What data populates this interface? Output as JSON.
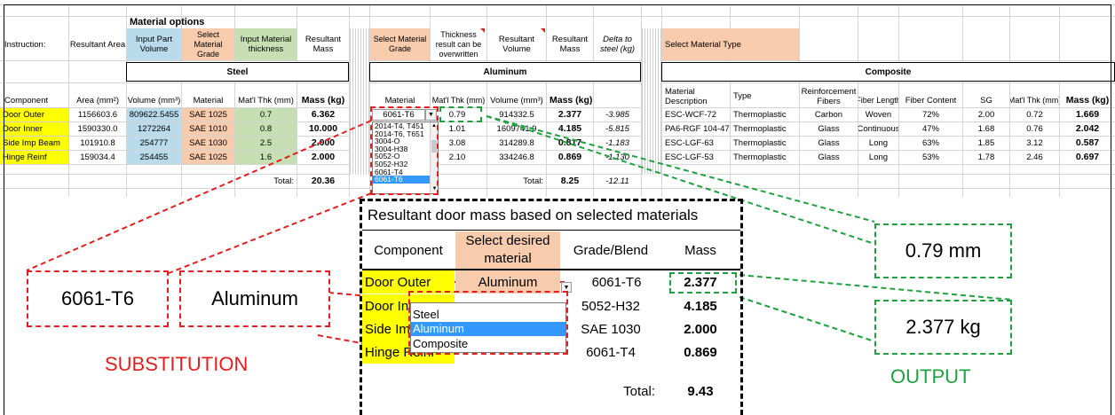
{
  "spreadsheet": {
    "material_options_title": "Material options",
    "instruction_label": "Instruction:",
    "steel_headers": {
      "resultant_area": "Resultant Area",
      "input_part_volume": "Input Part Volume",
      "select_material_grade": "Select Material Grade",
      "input_material_thickness": "Input Material thickness",
      "resultant_mass": "Resultant Mass"
    },
    "aluminum_headers": {
      "select_material_grade": "Select Material Grade",
      "thickness_note": "Thickness result can be overwritten",
      "resultant_volume": "Resultant Volume",
      "resultant_mass": "Resultant Mass",
      "delta_to_steel": "Delta to steel (kg)"
    },
    "composite_headers": {
      "select_material_type": "Select Material Type"
    },
    "section_titles": {
      "steel": "Steel",
      "aluminum": "Aluminum",
      "composite": "Composite"
    },
    "steel_columns": [
      "Component",
      "Area (mm²)",
      "Volume (mm³)",
      "Material",
      "Mat'l Thk (mm)",
      "Mass (kg)"
    ],
    "aluminum_columns": [
      "Material",
      "Mat'l Thk (mm)",
      "Volume (mm³)",
      "Mass (kg)"
    ],
    "composite_columns": [
      "Material Description",
      "Type",
      "Reinforcement Fibers",
      "Fiber Length",
      "Fiber Content",
      "SG",
      "Mat'l Thk (mm)",
      "Mass (kg)"
    ],
    "rows": [
      {
        "component": "Door Outer",
        "area": "1156603.6",
        "volume": "809622.5455",
        "material": "SAE 1025",
        "thk": "0.7",
        "mass": "6.362",
        "al_material": "6061-T6",
        "al_thk": "0.79",
        "al_volume": "914332.5",
        "al_mass": "2.377",
        "delta": "-3.985",
        "c_desc": "ESC-WCF-72",
        "c_type": "Thermoplastic",
        "c_fiber": "Carbon",
        "c_len": "Woven",
        "c_content": "72%",
        "c_sg": "2.00",
        "c_thk": "0.72",
        "c_mass": "1.669"
      },
      {
        "component": "Door Inner",
        "area": "1590330.0",
        "volume": "1272264",
        "material": "SAE 1010",
        "thk": "0.8",
        "mass": "10.000",
        "al_material": "",
        "al_thk": "1.01",
        "al_volume": "1609741.9",
        "al_mass": "4.185",
        "delta": "-5.815",
        "c_desc": "PA6-RGF 104-47",
        "c_type": "Thermoplastic",
        "c_fiber": "Glass",
        "c_len": "Continuous",
        "c_content": "47%",
        "c_sg": "1.68",
        "c_thk": "0.76",
        "c_mass": "2.042"
      },
      {
        "component": "Side Imp Beam",
        "area": "101910.8",
        "volume": "254777",
        "material": "SAE 1030",
        "thk": "2.5",
        "mass": "2.000",
        "al_material": "",
        "al_thk": "3.08",
        "al_volume": "314289.8",
        "al_mass": "0.817",
        "delta": "-1.183",
        "c_desc": "ESC-LGF-63",
        "c_type": "Thermoplastic",
        "c_fiber": "Glass",
        "c_len": "Long",
        "c_content": "63%",
        "c_sg": "1.85",
        "c_thk": "3.12",
        "c_mass": "0.587"
      },
      {
        "component": "Hinge Reinf",
        "area": "159034.4",
        "volume": "254455",
        "material": "SAE 1025",
        "thk": "1.6",
        "mass": "2.000",
        "al_material": "",
        "al_thk": "2.10",
        "al_volume": "334246.8",
        "al_mass": "0.869",
        "delta": "-1.130",
        "c_desc": "ESC-LGF-53",
        "c_type": "Thermoplastic",
        "c_fiber": "Glass",
        "c_len": "Long",
        "c_content": "53%",
        "c_sg": "1.78",
        "c_thk": "2.46",
        "c_mass": "0.697"
      }
    ],
    "total_label": "Total:",
    "steel_total": "20.36",
    "al_total": "8.25",
    "delta_total": "-12.11",
    "aluminum_dropdown_options": [
      "2014-T4, T451",
      "2014-T6, T651",
      "3004-O",
      "3004-H38",
      "5052-O",
      "5052-H32",
      "6061-T4",
      "6061-T6"
    ],
    "aluminum_dropdown_selected": "6061-T6"
  },
  "summary_table": {
    "title": "Resultant door mass based on selected materials",
    "columns": [
      "Component",
      "Select desired material",
      "Grade/Blend",
      "Mass"
    ],
    "rows": [
      {
        "component": "Door Outer",
        "material": "Aluminum",
        "grade": "6061-T6",
        "mass": "2.377"
      },
      {
        "component": "Door Inner",
        "material": "",
        "grade": "5052-H32",
        "mass": "4.185"
      },
      {
        "component": "Side Imp Beam",
        "material": "",
        "grade": "SAE 1030",
        "mass": "2.000"
      },
      {
        "component": "Hinge Reinf",
        "material": "",
        "grade": "6061-T4",
        "mass": "0.869"
      }
    ],
    "total_label": "Total:",
    "total": "9.43",
    "material_dropdown_options": [
      "Steel",
      "Aluminum",
      "Composite"
    ],
    "material_dropdown_selected": "Aluminum"
  },
  "annotations": {
    "callout_grade": "6061-T6",
    "callout_material": "Aluminum",
    "callout_thickness": "0.79 mm",
    "callout_mass": "2.377 kg",
    "substitution_label": "SUBSTITUTION",
    "output_label": "OUTPUT",
    "colors": {
      "substitution": "#e02020",
      "output": "#20a040"
    }
  }
}
